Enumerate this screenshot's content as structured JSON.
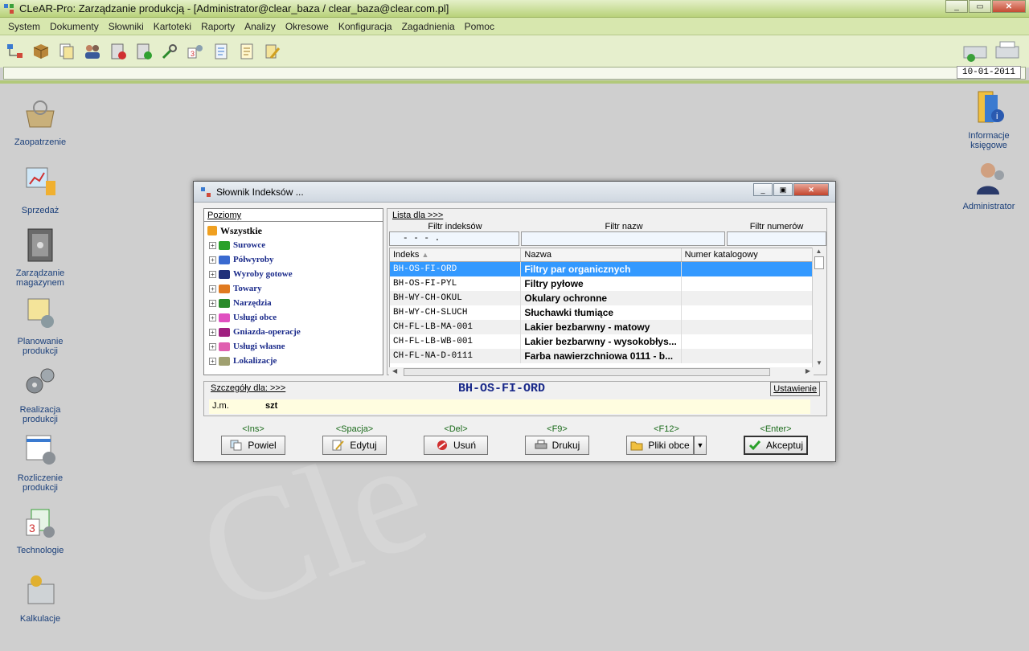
{
  "app": {
    "title": "CLeAR-Pro:  Zarządzanie produkcją - [Administrator@clear_baza / clear_baza@clear.com.pl]",
    "date": "10-01-2011",
    "watermark": "Cle"
  },
  "menu": [
    "System",
    "Dokumenty",
    "Słowniki",
    "Kartoteki",
    "Raporty",
    "Analizy",
    "Okresowe",
    "Konfiguracja",
    "Zagadnienia",
    "Pomoc"
  ],
  "desktop_left": [
    "Zaopatrzenie",
    "Sprzedaż",
    "Zarządzanie magazynem",
    "Planowanie produkcji",
    "Realizacja produkcji",
    "Rozliczenie produkcji",
    "Technologie",
    "Kalkulacje"
  ],
  "desktop_right": [
    "Informacje księgowe",
    "Administrator"
  ],
  "dialog": {
    "title": "Słownik Indeksów ...",
    "levels_label": "Poziomy",
    "tree_root": "Wszystkie",
    "tree": [
      {
        "label": "Surowce",
        "color": "#2aa02a"
      },
      {
        "label": "Półwyroby",
        "color": "#3a6ad0"
      },
      {
        "label": "Wyroby gotowe",
        "color": "#20307a"
      },
      {
        "label": "Towary",
        "color": "#e07a20"
      },
      {
        "label": "Narzędzia",
        "color": "#2a8a2a"
      },
      {
        "label": "Usługi obce",
        "color": "#e050c0"
      },
      {
        "label": "Gniazda-operacje",
        "color": "#a02080"
      },
      {
        "label": "Usługi własne",
        "color": "#e060b0"
      },
      {
        "label": "Lokalizacje",
        "color": "#a0a070"
      }
    ],
    "list_label": "Lista dla >>>",
    "filters": {
      "index": "Filtr indeksów",
      "index_value": "-  -  -        .",
      "name": "Filtr nazw",
      "number": "Filtr numerów"
    },
    "columns": [
      "Indeks",
      "Nazwa",
      "Numer katalogowy"
    ],
    "sort_mark": "▲",
    "rows": [
      {
        "index": "BH-OS-FI-ORD",
        "name": "Filtry par organicznych",
        "num": ""
      },
      {
        "index": "BH-OS-FI-PYL",
        "name": "Filtry pyłowe",
        "num": ""
      },
      {
        "index": "BH-WY-CH-OKUL",
        "name": "Okulary ochronne",
        "num": ""
      },
      {
        "index": "BH-WY-CH-SLUCH",
        "name": "Słuchawki tłumiące",
        "num": ""
      },
      {
        "index": "CH-FL-LB-MA-001",
        "name": "Lakier bezbarwny - matowy",
        "num": ""
      },
      {
        "index": "CH-FL-LB-WB-001",
        "name": "Lakier bezbarwny - wysokobłys...",
        "num": ""
      },
      {
        "index": "CH-FL-NA-D-0111",
        "name": "Farba nawierzchniowa 0111 - b...",
        "num": ""
      }
    ],
    "details_label": "Szczegóły dla: >>>",
    "selected_code": "BH-OS-FI-ORD",
    "settings_button": "Ustawienie",
    "unit_label": "J.m.",
    "unit_value": "szt",
    "buttons": [
      {
        "key": "<Ins>",
        "label": "Powiel"
      },
      {
        "key": "<Spacja>",
        "label": "Edytuj"
      },
      {
        "key": "<Del>",
        "label": "Usuń"
      },
      {
        "key": "<F9>",
        "label": "Drukuj"
      },
      {
        "key": "<F12>",
        "label": "Pliki obce"
      },
      {
        "key": "<Enter>",
        "label": "Akceptuj"
      }
    ]
  },
  "colors": {
    "accent": "#b9d27a",
    "selection": "#3399ff",
    "code": "#1a2a8a"
  }
}
